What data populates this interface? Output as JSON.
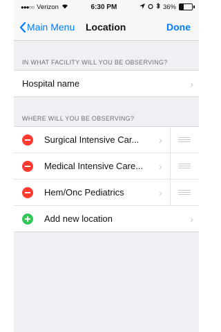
{
  "status": {
    "carrier": "Verizon",
    "time": "6:30 PM",
    "battery": "36%"
  },
  "nav": {
    "back_label": "Main Menu",
    "title": "Location",
    "done_label": "Done"
  },
  "facility_section": {
    "header": "IN WHAT FACILITY WILL YOU BE OBSERVING?",
    "hospital_label": "Hospital name"
  },
  "locations_section": {
    "header": "WHERE WILL YOU BE OBSERVING?",
    "items": [
      {
        "label": "Surgical Intensive Car..."
      },
      {
        "label": "Medical Intensive Care..."
      },
      {
        "label": "Hem/Onc Pediatrics"
      }
    ],
    "add_label": "Add new location"
  },
  "colors": {
    "accent": "#007aff",
    "delete": "#ff3b30",
    "add": "#34c759",
    "background": "#efeff4"
  }
}
